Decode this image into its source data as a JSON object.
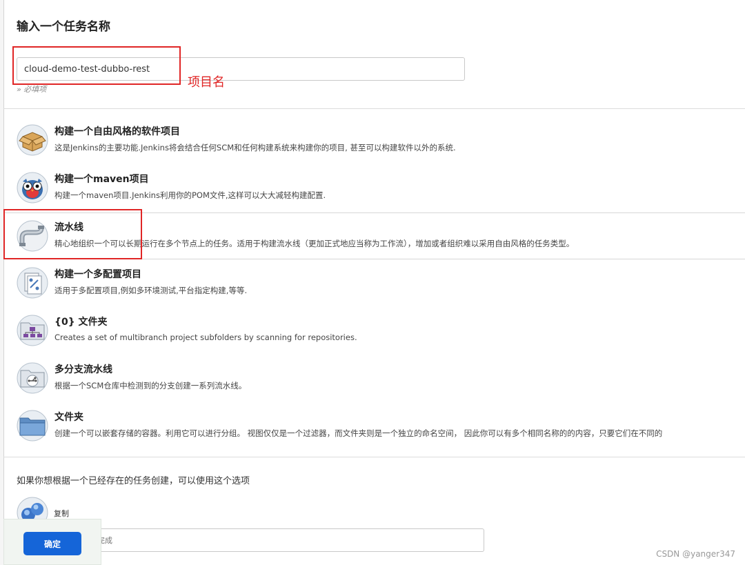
{
  "header": {
    "title": "输入一个任务名称"
  },
  "name_field": {
    "value": "cloud-demo-test-dubbo-rest",
    "hint": "» 必填项"
  },
  "annotation": {
    "label": "项目名",
    "color": "#e02525"
  },
  "job_types": [
    {
      "id": "freestyle",
      "icon": "freestyle-package-icon",
      "title": "构建一个自由风格的软件项目",
      "desc": "这是Jenkins的主要功能.Jenkins将会结合任何SCM和任何构建系统来构建你的项目, 甚至可以构建软件以外的系统."
    },
    {
      "id": "maven",
      "icon": "maven-owl-icon",
      "title": "构建一个maven项目",
      "desc": "构建一个maven项目.Jenkins利用你的POM文件,这样可以大大减轻构建配置."
    },
    {
      "id": "pipeline",
      "icon": "pipeline-pipe-icon",
      "title": "流水线",
      "desc": "精心地组织一个可以长期运行在多个节点上的任务。适用于构建流水线（更加正式地应当称为工作流），增加或者组织难以采用自由风格的任务类型。"
    },
    {
      "id": "matrix",
      "icon": "multi-config-icon",
      "title": "构建一个多配置项目",
      "desc": "适用于多配置项目,例如多环境测试,平台指定构建,等等."
    },
    {
      "id": "org-folder",
      "icon": "org-folder-icon",
      "title": "{0} 文件夹",
      "desc": "Creates a set of multibranch project subfolders by scanning for repositories."
    },
    {
      "id": "multibranch",
      "icon": "multibranch-pipeline-icon",
      "title": "多分支流水线",
      "desc": "根据一个SCM仓库中检测到的分支创建一系列流水线。"
    },
    {
      "id": "folder",
      "icon": "folder-icon",
      "title": "文件夹",
      "desc": "创建一个可以嵌套存储的容器。利用它可以进行分组。 视图仅仅是一个过滤器，而文件夹则是一个独立的命名空间， 因此你可以有多个相同名称的的内容，只要它们在不同的"
    }
  ],
  "selected_type": "pipeline",
  "copy_section": {
    "text": "如果你想根据一个已经存在的任务创建，可以使用这个选项",
    "icon": "copy-orbs-icon",
    "label": "复制",
    "placeholder": "自动完成"
  },
  "footer": {
    "ok_label": "确定"
  },
  "watermark": "CSDN @yanger347",
  "colors": {
    "accent": "#1565d8",
    "annotation": "#e02525"
  }
}
